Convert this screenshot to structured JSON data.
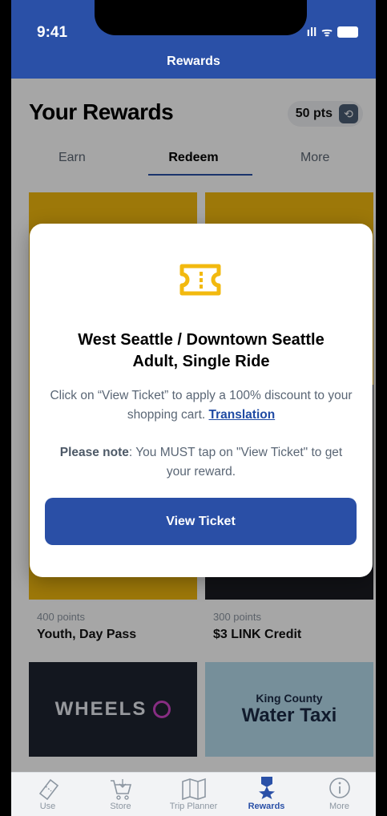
{
  "status": {
    "time": "9:41",
    "signal": "ıll",
    "wifi": "ᯤ"
  },
  "nav": {
    "title": "Rewards"
  },
  "page": {
    "title": "Your Rewards",
    "points": "50 pts"
  },
  "tabs": [
    "Earn",
    "Redeem",
    "More"
  ],
  "cards": [
    {
      "points": "400 points",
      "name": "Youth, Day Pass",
      "color": "#f2b90f"
    },
    {
      "points": "300 points",
      "name": "$3 LINK Credit",
      "color": "#f2b90f"
    }
  ],
  "brand_cards": {
    "wheels": "WHEELS",
    "kc": "King County",
    "wt": "Water Taxi"
  },
  "modal": {
    "title_line1": "West Seattle / Downtown Seattle",
    "title_line2": "Adult, Single Ride",
    "body": "Click on “View Ticket” to apply a 100% discount to your shopping cart.",
    "link": "Translation",
    "note_label": "Please note",
    "note_text": ": You MUST tap on \"View Ticket\" to get your reward.",
    "button": "View Ticket",
    "icon": "ticket-icon",
    "accent": "#f2b90f"
  },
  "tabbar": [
    {
      "label": "Use",
      "icon": "ticket-icon"
    },
    {
      "label": "Store",
      "icon": "cart-icon"
    },
    {
      "label": "Trip Planner",
      "icon": "map-icon"
    },
    {
      "label": "Rewards",
      "icon": "medal-icon"
    },
    {
      "label": "More",
      "icon": "info-icon"
    }
  ],
  "colors": {
    "brand": "#2a50a7",
    "accent": "#f2b90f"
  }
}
